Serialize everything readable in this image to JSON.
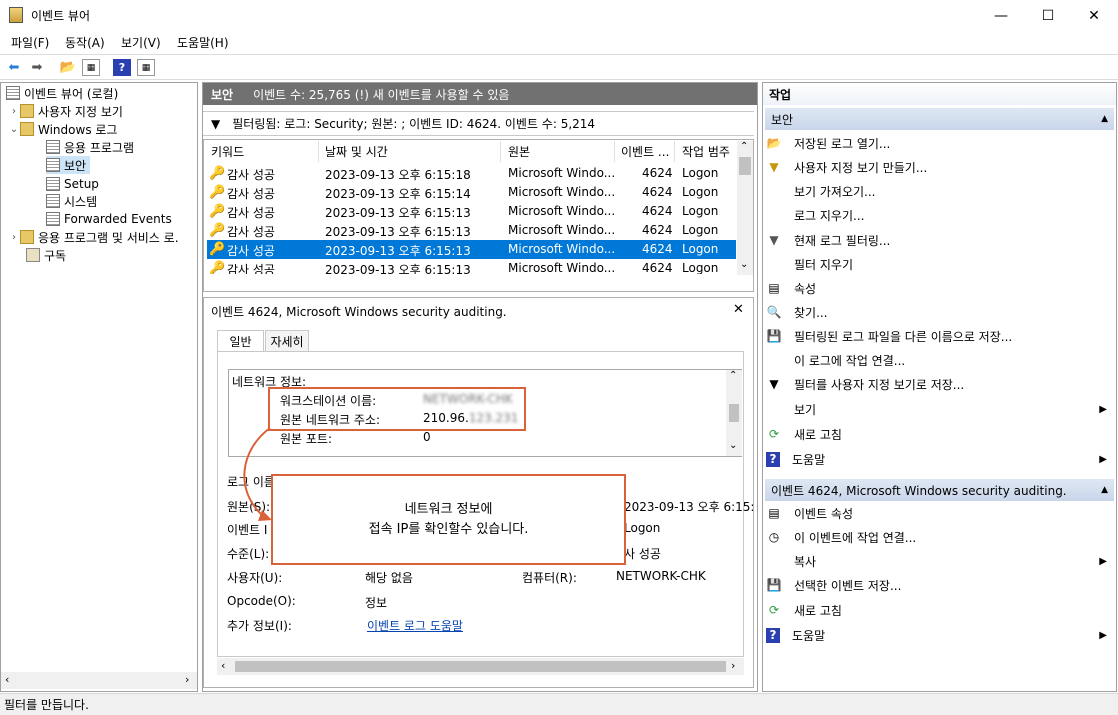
{
  "window": {
    "title": "이벤트 뷰어",
    "minimize": "—",
    "maximize": "☐",
    "close": "✕"
  },
  "menu": [
    "파일(F)",
    "동작(A)",
    "보기(V)",
    "도움말(H)"
  ],
  "tree": {
    "root": "이벤트 뷰어 (로컬)",
    "custom_views": "사용자 지정 보기",
    "windows_logs": "Windows 로그",
    "application": "응용 프로그램",
    "security": "보안",
    "setup": "Setup",
    "system": "시스템",
    "forwarded": "Forwarded Events",
    "app_services": "응용 프로그램 및 서비스 로.",
    "subscriptions": "구독"
  },
  "center": {
    "header_title": "보안",
    "header_info": "이벤트 수: 25,765 (!) 새 이벤트를 사용할 수 있음",
    "filter_text": "필터링됨: 로그: Security; 원본: ; 이벤트 ID: 4624. 이벤트 수: 5,214",
    "columns": [
      "키워드",
      "날짜 및 시간",
      "원본",
      "이벤트 ...",
      "작업 범주"
    ],
    "rows": [
      {
        "kw": "감사 성공",
        "dt": "2023-09-13 오후 6:15:18",
        "src": "Microsoft Windo...",
        "id": "4624",
        "cat": "Logon"
      },
      {
        "kw": "감사 성공",
        "dt": "2023-09-13 오후 6:15:14",
        "src": "Microsoft Windo...",
        "id": "4624",
        "cat": "Logon"
      },
      {
        "kw": "감사 성공",
        "dt": "2023-09-13 오후 6:15:13",
        "src": "Microsoft Windo...",
        "id": "4624",
        "cat": "Logon"
      },
      {
        "kw": "감사 성공",
        "dt": "2023-09-13 오후 6:15:13",
        "src": "Microsoft Windo...",
        "id": "4624",
        "cat": "Logon"
      },
      {
        "kw": "감사 성공",
        "dt": "2023-09-13 오후 6:15:13",
        "src": "Microsoft Windo...",
        "id": "4624",
        "cat": "Logon"
      },
      {
        "kw": "감사 성공",
        "dt": "2023-09-13 오후 6:15:13",
        "src": "Microsoft Windo...",
        "id": "4624",
        "cat": "Logon"
      }
    ]
  },
  "detail": {
    "title": "이벤트 4624, Microsoft Windows security auditing.",
    "close": "✕",
    "tab_general": "일반",
    "tab_details": "자세히",
    "net_info": "네트워크 정보:",
    "ws_label": "워크스테이션 이름:",
    "ws_value": "NETWORK-CHK",
    "addr_label": "원본 네트워크 주소:",
    "addr_value": "210.96.",
    "addr_blur": "123.231",
    "port_label": "원본 포트:",
    "port_value": "0",
    "log_name_label": "로그 이름",
    "source_label": "원본(S):",
    "date_value": "2023-09-13 오후 6:15:",
    "event_label": "이벤트 I",
    "task_value": "Logon",
    "level_label": "수준(L):",
    "keyword_value": "사 성공",
    "user_label": "사용자(U):",
    "user_value": "해당 없음",
    "computer_label": "컴퓨터(R):",
    "computer_value": "NETWORK-CHK",
    "opcode_label": "Opcode(O):",
    "opcode_value": "정보",
    "more_label": "추가 정보(I):",
    "more_link": "이벤트 로그 도움말",
    "callout_line1": "네트워크 정보에",
    "callout_line2": "접속 IP를 확인할수 있습니다."
  },
  "actions": {
    "header": "작업",
    "section1": "보안",
    "items1": [
      "저장된 로그 열기...",
      "사용자 지정 보기 만들기...",
      "보기 가져오기...",
      "로그 지우기...",
      "현재 로그 필터링...",
      "필터 지우기",
      "속성",
      "찾기...",
      "필터링된 로그 파일을 다른 이름으로 저장...",
      "이 로그에 작업 연결...",
      "필터를 사용자 지정 보기로 저장...",
      "보기",
      "새로 고침",
      "도움말"
    ],
    "section2": "이벤트 4624, Microsoft Windows security auditing.",
    "items2": [
      "이벤트 속성",
      "이 이벤트에 작업 연결...",
      "복사",
      "선택한 이벤트 저장...",
      "새로 고침",
      "도움말"
    ]
  },
  "status": "필터를 만듭니다."
}
